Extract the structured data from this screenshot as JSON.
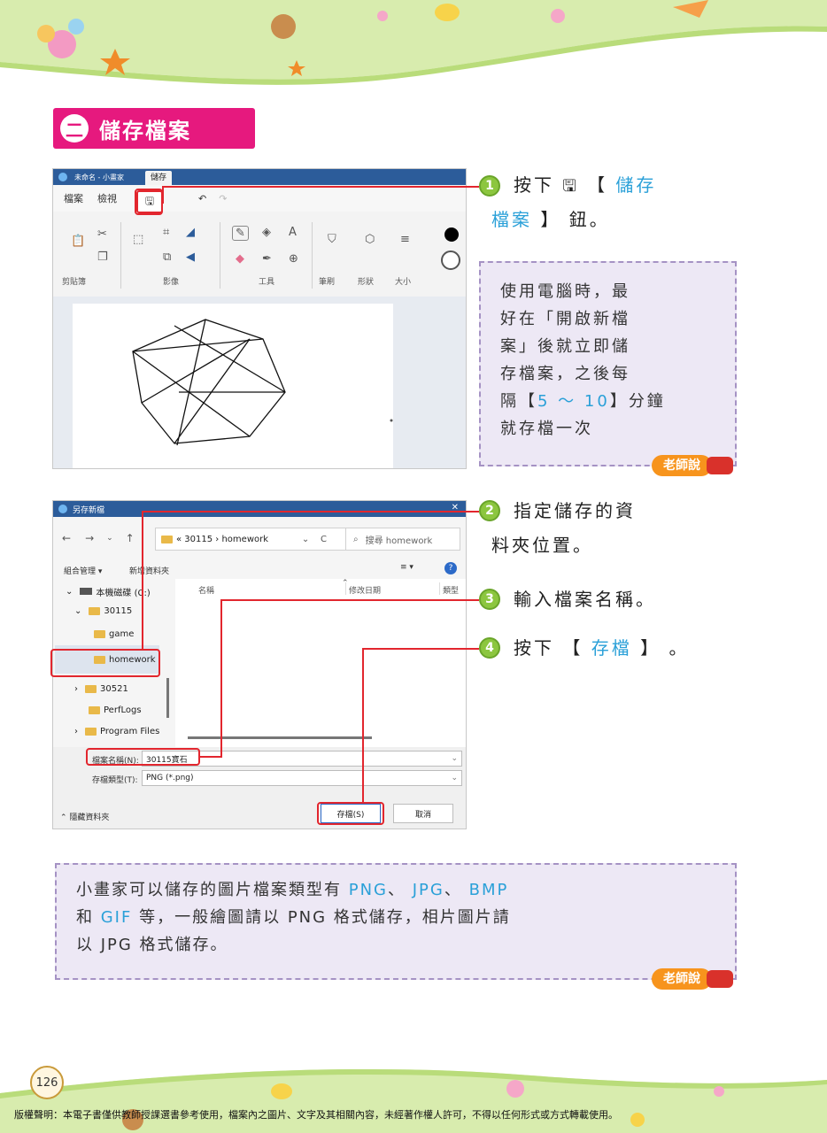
{
  "section": {
    "number": "二",
    "title": "儲存檔案"
  },
  "paint": {
    "title": "未命名 - 小畫家",
    "save_tab": "儲存",
    "menu": [
      "檔案",
      "檢視"
    ],
    "groups": [
      "剪貼簿",
      "影像",
      "工具",
      "筆刷",
      "形狀",
      "大小"
    ],
    "text_tool": "A"
  },
  "saveas": {
    "title": "另存新檔",
    "close": "✕",
    "path": "« 30115 › homework",
    "search_placeholder": "搜尋 homework",
    "organize": "組合管理 ▾",
    "new_folder": "新增資料夾",
    "tree": {
      "drive": "本機磁碟 (C:)",
      "folder_30115": "30115",
      "game": "game",
      "homework": "homework",
      "folder_30521": "30521",
      "perflogs": "PerfLogs",
      "program_files": "Program Files"
    },
    "columns": {
      "name": "名稱",
      "modified": "修改日期",
      "type": "類型"
    },
    "filename_label": "檔案名稱(N):",
    "filename_value": "30115寶石",
    "filetype_label": "存檔類型(T):",
    "filetype_value": "PNG (*.png)",
    "hide_folders": "隱藏資料夾",
    "save_button": "存檔(S)",
    "cancel_button": "取消"
  },
  "steps": [
    {
      "num": "1",
      "pre": "按下",
      "icon": "🖫",
      "open": "【",
      "name_line1": "儲存",
      "name_line2": "檔案",
      "close": "】",
      "post": "鈕。"
    },
    {
      "num": "2",
      "line1": "指定儲存的資",
      "line2": "料夾位置。"
    },
    {
      "num": "3",
      "text": "輸入檔案名稱。"
    },
    {
      "num": "4",
      "pre": "按下",
      "open": "【",
      "name": "存檔",
      "close": "】",
      "post": "。"
    }
  ],
  "note1": {
    "lines": [
      "使用電腦時，最",
      "好在「開啟新檔",
      "案」後就立即儲",
      "存檔案，之後每"
    ],
    "line5_pre": "隔",
    "line5_open": "【",
    "line5_value": "5 ～ 10",
    "line5_close": "】",
    "line5_post": "分鐘",
    "line6": "就存檔一次",
    "badge": "老師說"
  },
  "note2": {
    "line1_pre": "小畫家可以儲存的圖片檔案類型有",
    "formats": [
      "PNG",
      "JPG",
      "BMP",
      "GIF"
    ],
    "line1_sep": "、",
    "line2_pre": "和",
    "line2_post": "等，一般繪圖請以 PNG 格式儲存，相片圖片請",
    "line3": "以 JPG 格式儲存。",
    "badge": "老師說"
  },
  "footer": {
    "page_number": "126",
    "copyright": "版權聲明：本電子書僅供教師授課選書參考使用，檔案內之圖片、文字及其相關內容，未經著作權人許可，不得以任何形式或方式轉載使用。"
  },
  "colors": {
    "accent": "#e6197e",
    "highlight": "#e2262e",
    "step": "#8cc63f",
    "link": "#2aa0d8",
    "note_bg": "#ede8f5"
  }
}
